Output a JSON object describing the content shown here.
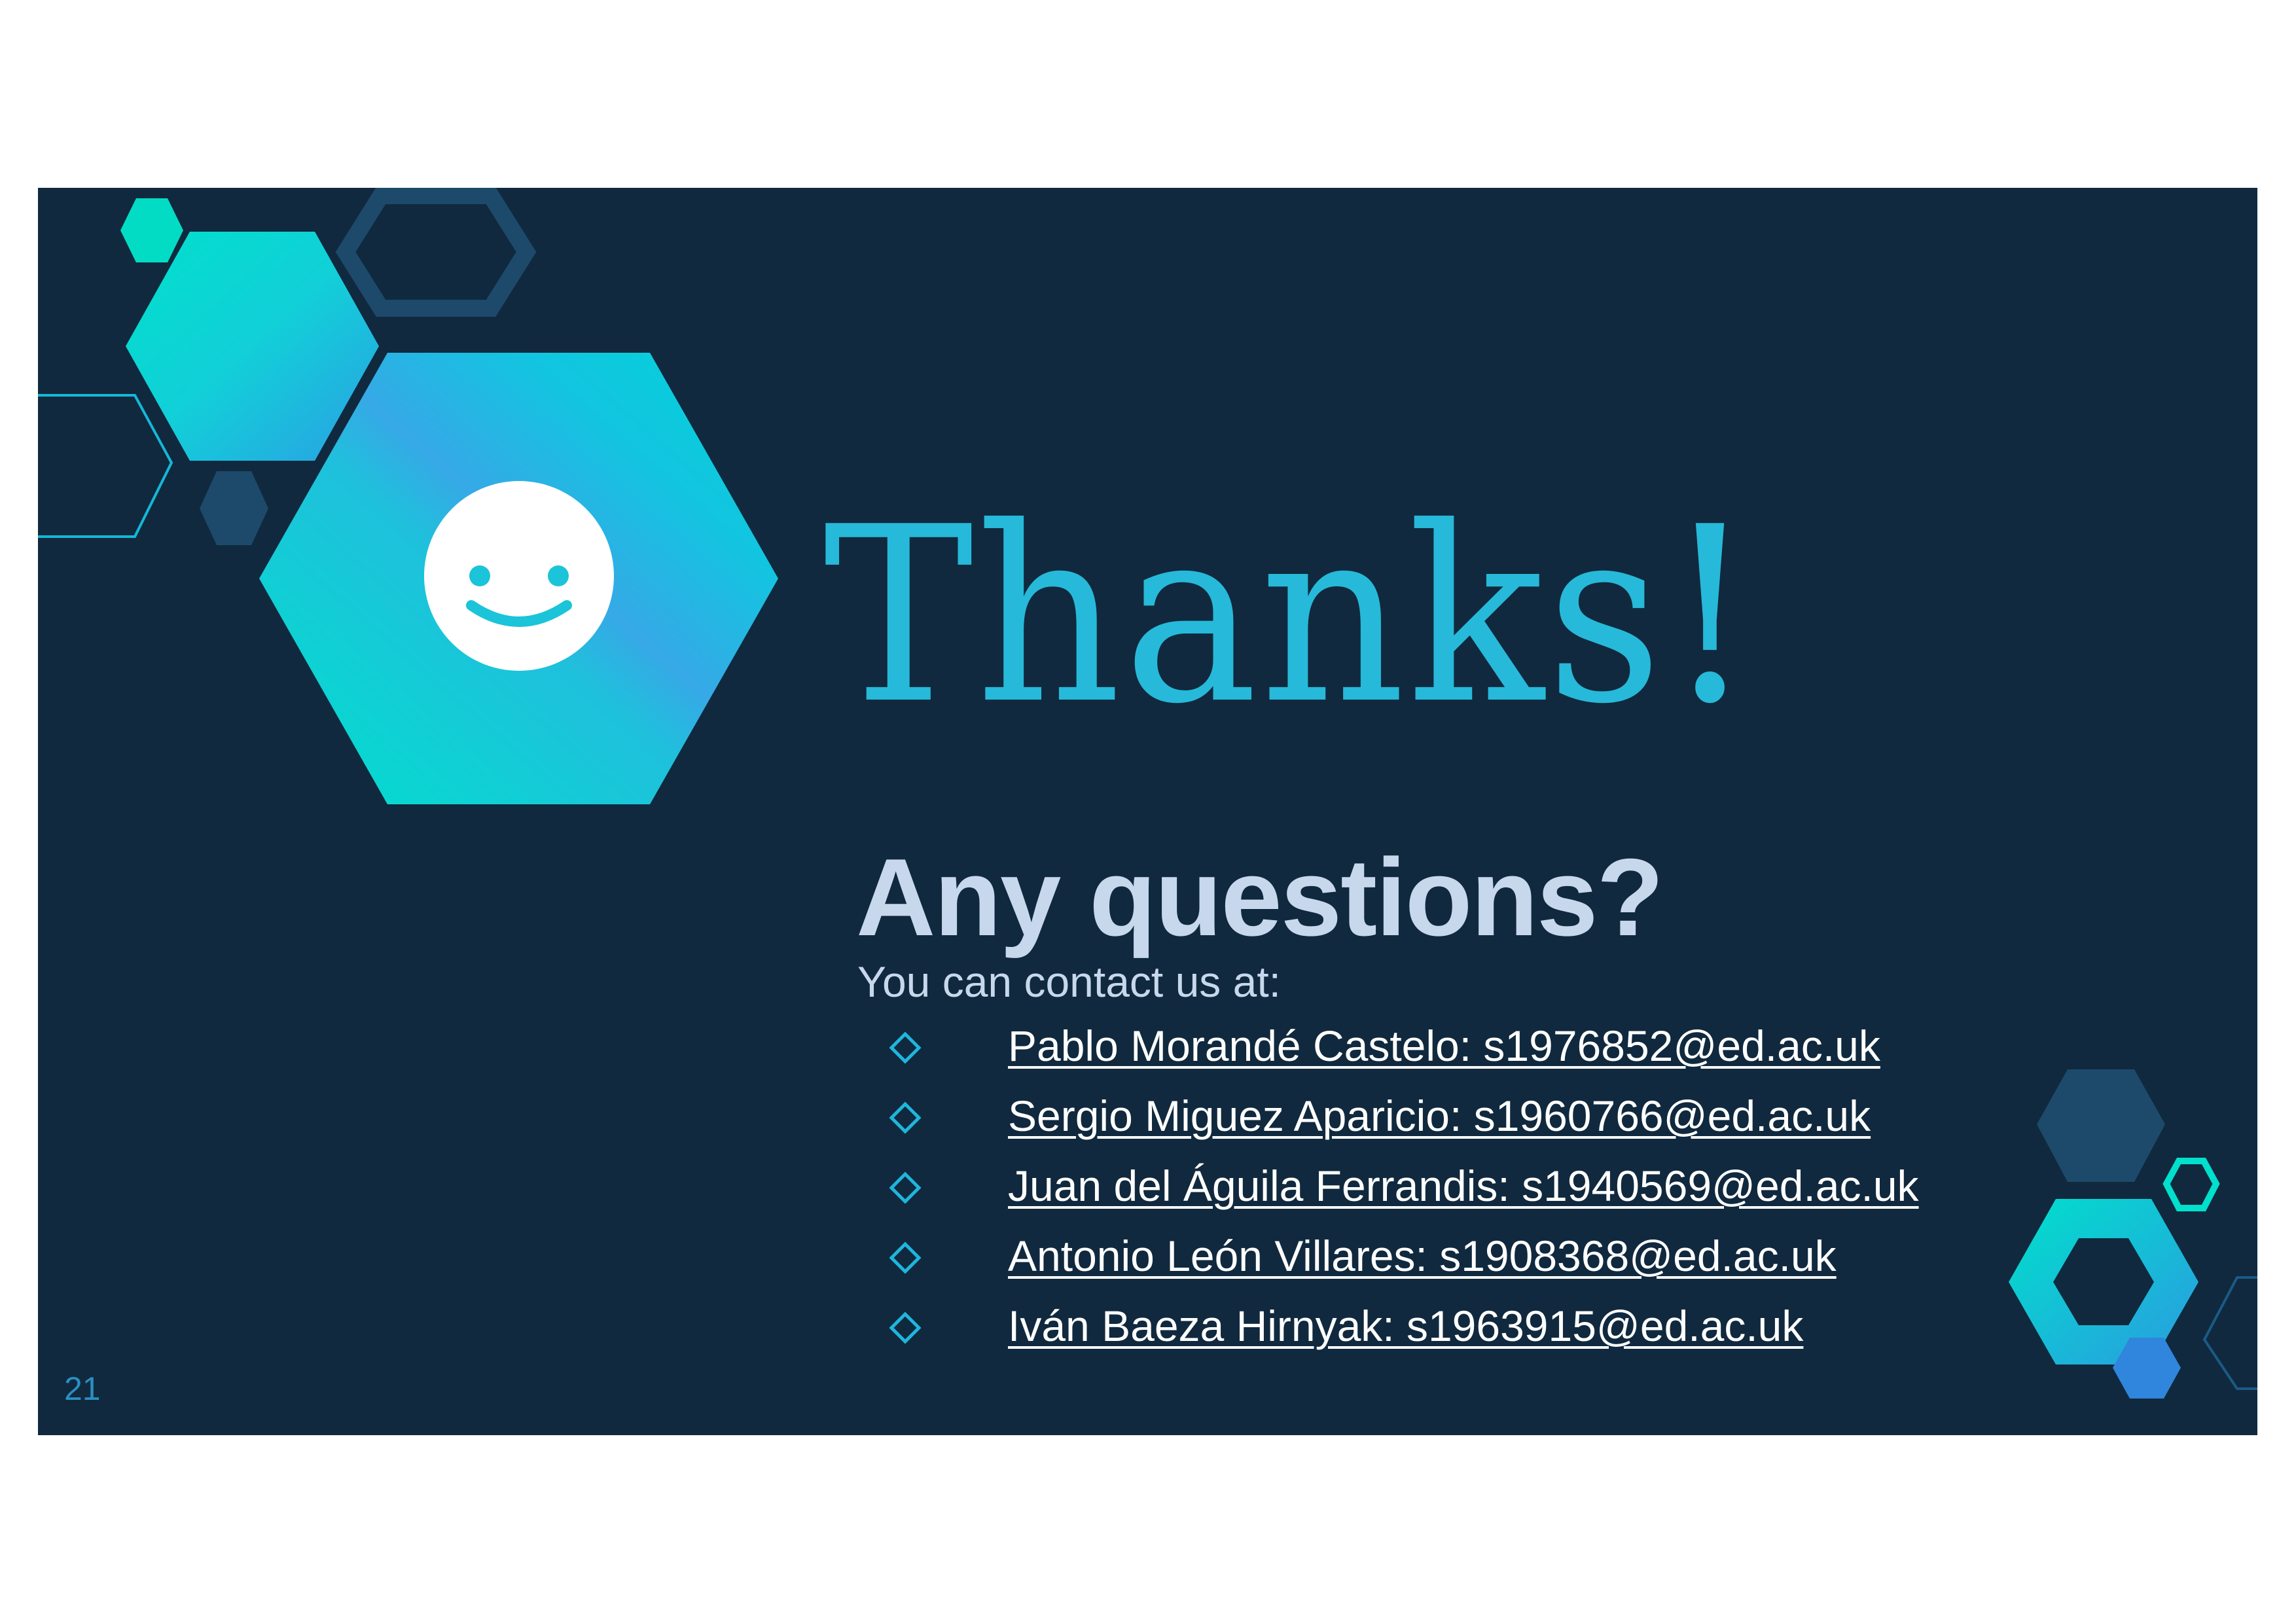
{
  "slide": {
    "title": "Thanks!",
    "subtitle": "Any questions?",
    "contact_intro": "You can contact us at:",
    "contacts": [
      "Pablo Morandé Castelo: s1976852@ed.ac.uk",
      "Sergio Miguez Aparicio: s1960766@ed.ac.uk",
      "Juan del Águila Ferrandis: s1940569@ed.ac.uk",
      "Antonio León Villares: s1908368@ed.ac.uk",
      "Iván Baeza Hirnyak: s1963915@ed.ac.uk"
    ],
    "page_number": "21"
  },
  "icons": {
    "smiley": "smiley-face-icon",
    "bullet": "diamond-outline-icon"
  },
  "colors": {
    "background": "#10293e",
    "title": "#27b9d9",
    "subtitle": "#c7d8ec",
    "accent_teal": "#00e0c8",
    "accent_blue": "#2b9be0",
    "hex_dark": "#1d4a6b",
    "link": "#ffffff"
  }
}
